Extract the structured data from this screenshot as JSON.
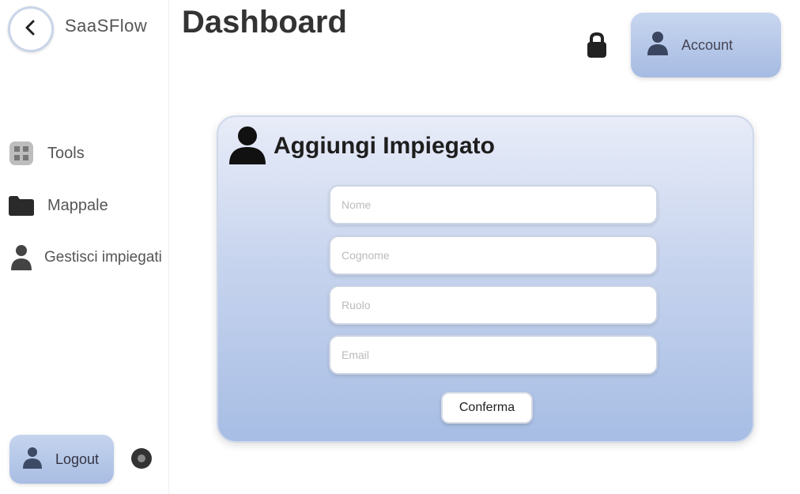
{
  "app": {
    "brand": "SaaSFlow",
    "title": "Dashboard"
  },
  "header": {
    "account_label": "Account",
    "notification_icon": "lock-icon",
    "account_icon": "user-icon"
  },
  "sidebar": {
    "items": [
      {
        "label": "Tools",
        "icon": "grid-icon"
      },
      {
        "label": "Mappale",
        "icon": "folder-icon"
      },
      {
        "label": "Gestisci impiegati",
        "icon": "user-icon"
      }
    ],
    "logout_label": "Logout",
    "logout_icon": "user-icon",
    "settings_icon": "gear-icon",
    "back_icon": "chevron-left-icon"
  },
  "form": {
    "title": "Aggiungi Impiegato",
    "icon": "user-icon",
    "fields": [
      {
        "placeholder": "Nome",
        "value": ""
      },
      {
        "placeholder": "Cognome",
        "value": ""
      },
      {
        "placeholder": "Ruolo",
        "value": ""
      },
      {
        "placeholder": "Email",
        "value": ""
      }
    ],
    "confirm_label": "Conferma"
  },
  "colors": {
    "accent": "#a9bde3",
    "card_top": "#e8ecf8",
    "card_bottom": "#a7bde4"
  }
}
